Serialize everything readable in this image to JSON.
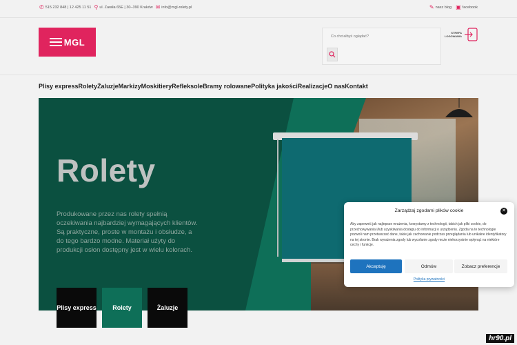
{
  "topbar": {
    "phones": "515 232 848 | 12 425 11 51",
    "address": "ul. Zawiła 65E | 30–390 Kraków",
    "email": "info@mgl-rolety.pl",
    "blog": "nasz blog",
    "facebook": "facebook"
  },
  "header": {
    "logo_text": "MGL",
    "search_placeholder": "Co chciałbyś oglądać?",
    "login_label": "STREFA LOGOWANIA"
  },
  "nav": {
    "items": [
      "Plisy express",
      "Rolety",
      "Żaluzje",
      "Markizy",
      "Moskitiery",
      "Refleksole",
      "Bramy rolowane",
      "Polityka jakości",
      "Realizacje",
      "O nas",
      "Kontakt"
    ]
  },
  "hero": {
    "title": "Rolety",
    "text": "Produkowane przez nas rolety spełnią oczekiwania najbardziej wymagających klientów. Są praktyczne, proste w montażu i obsłudze, a do tego bardzo modne. Materiał użyty do produkcji osłon dostępny jest w wielu kolorach.",
    "cards": [
      "Plisy express",
      "Rolety",
      "Żaluzje"
    ]
  },
  "cookie": {
    "title": "Zarządzaj zgodami plików cookie",
    "text": "Aby zapewnić jak najlepsze wrażenia, korzystamy z technologii, takich jak pliki cookie, do przechowywania i/lub uzyskiwania dostępu do informacji o urządzeniu. Zgoda na te technologie pozwoli nam przetwarzać dane, takie jak zachowanie podczas przeglądania lub unikalne identyfikatory na tej stronie. Brak wyrażenia zgody lub wycofanie zgody może niekorzystnie wpłynąć na niektóre cechy i funkcje.",
    "accept": "Akceptuję",
    "deny": "Odmów",
    "prefs": "Zobacz preferencje",
    "privacy_link": "Polityka prywatności"
  },
  "watermark": "hr90.pl",
  "colors": {
    "brand": "#e0245e",
    "hero_green": "#0e6f58",
    "accept_blue": "#1e73be"
  }
}
